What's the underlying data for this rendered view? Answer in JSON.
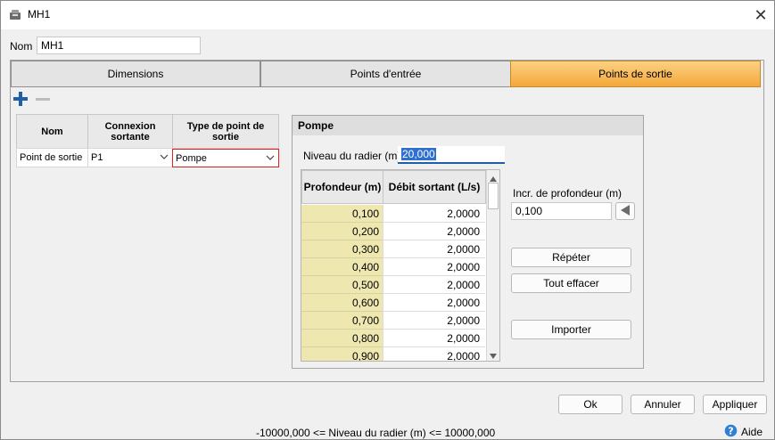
{
  "window": {
    "title": "MH1",
    "close_glyph": "✕"
  },
  "nom": {
    "label": "Nom",
    "value": "MH1"
  },
  "tabs": [
    {
      "label": "Dimensions",
      "active": false
    },
    {
      "label": "Points d'entrée",
      "active": false
    },
    {
      "label": "Points de sortie",
      "active": true
    }
  ],
  "toolbar": {
    "add_icon": "plus-icon",
    "remove_icon": "minus-icon"
  },
  "outlet_table": {
    "headers": [
      "Nom",
      "Connexion sortante",
      "Type de point de sortie"
    ],
    "rows": [
      {
        "nom": "Point de sortie",
        "connexion": "P1",
        "type": "Pompe"
      }
    ]
  },
  "pompe": {
    "title": "Pompe",
    "niveau_label": "Niveau du radier (m)",
    "niveau_value": "20,000",
    "table": {
      "headers": [
        "Profondeur (m)",
        "Débit sortant (L/s)"
      ],
      "rows": [
        [
          "0,100",
          "2,0000"
        ],
        [
          "0,200",
          "2,0000"
        ],
        [
          "0,300",
          "2,0000"
        ],
        [
          "0,400",
          "2,0000"
        ],
        [
          "0,500",
          "2,0000"
        ],
        [
          "0,600",
          "2,0000"
        ],
        [
          "0,700",
          "2,0000"
        ],
        [
          "0,800",
          "2,0000"
        ],
        [
          "0,900",
          "2,0000"
        ]
      ]
    },
    "incr_label": "Incr. de profondeur (m)",
    "incr_value": "0,100",
    "repeter_label": "Répéter",
    "tout_effacer_label": "Tout effacer",
    "importer_label": "Importer"
  },
  "footer": {
    "ok_label": "Ok",
    "annuler_label": "Annuler",
    "appliquer_label": "Appliquer",
    "status": "-10000,000 <= Niveau du radier (m) <= 10000,000",
    "aide_label": "Aide"
  },
  "colors": {
    "active_tab": "#f4a83a",
    "depth_cell": "#efe7b0",
    "selected_border": "#e02020",
    "accent_blue": "#1f5fa8"
  }
}
